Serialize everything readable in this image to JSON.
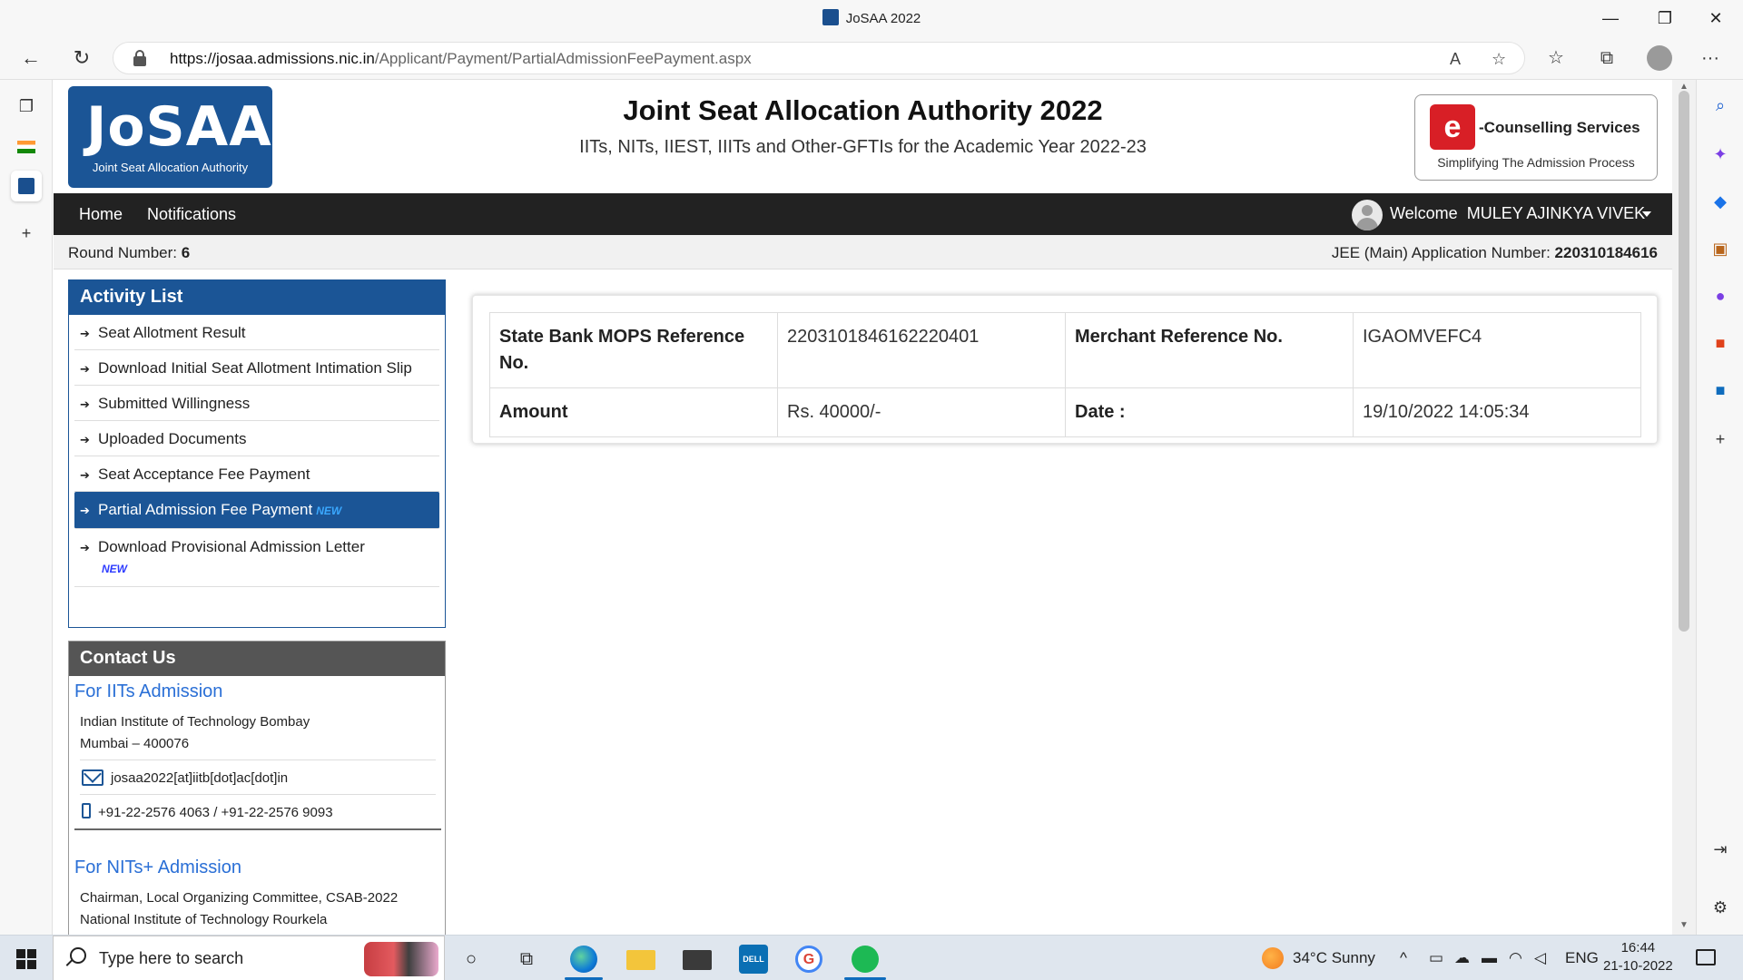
{
  "window": {
    "title": "JoSAA 2022",
    "minimize": "—",
    "restore": "❐",
    "close": "✕"
  },
  "browser": {
    "url_host": "https://josaa.admissions.nic.in",
    "url_path": "/Applicant/Payment/PartialAdmissionFeePayment.aspx",
    "back": "←",
    "reload": "↻",
    "more": "···",
    "read_aloud": "A",
    "fav_add": "☆",
    "favorites": "☆",
    "collections": "⧉"
  },
  "vtabs": {
    "tab_manager": "❐",
    "add_tab": "+"
  },
  "header": {
    "logo_text": "JoSAA",
    "logo_subtext": "Joint Seat Allocation Authority",
    "title": "Joint Seat Allocation Authority 2022",
    "subtitle": "IITs, NITs, IIEST, IIITs and Other-GFTIs for the Academic Year 2022-23",
    "ec_logo_letter": "e",
    "ec_logo_title": "-Counselling Services",
    "ec_logo_tagline": "Simplifying The Admission Process"
  },
  "menu": {
    "home": "Home",
    "notifications": "Notifications",
    "welcome": "Welcome",
    "user_name": "MULEY AJINKYA VIVEK"
  },
  "round": {
    "label": "Round Number:",
    "value": "6",
    "app_label": "JEE (Main) Application Number:",
    "app_value": "220310184616"
  },
  "activity": {
    "title": "Activity List",
    "items": [
      {
        "label": "Seat Allotment Result",
        "new": ""
      },
      {
        "label": "Download Initial Seat Allotment Intimation Slip",
        "new": ""
      },
      {
        "label": "Submitted Willingness",
        "new": ""
      },
      {
        "label": "Uploaded Documents",
        "new": ""
      },
      {
        "label": "Seat Acceptance Fee Payment",
        "new": ""
      },
      {
        "label": "Partial Admission Fee Payment",
        "new": "NEW"
      },
      {
        "label": "Download Provisional Admission Letter",
        "new": "NEW"
      }
    ]
  },
  "contact": {
    "title": "Contact Us",
    "iit_heading": "For IITs Admission",
    "iit_line1": "Indian Institute of Technology Bombay",
    "iit_line2": "Mumbai – 400076",
    "iit_email": "josaa2022[at]iitb[dot]ac[dot]in",
    "iit_phone": "+91-22-2576 4063 / +91-22-2576 9093",
    "nit_heading": "For NITs+ Admission",
    "nit_line1": "Chairman, Local Organizing Committee, CSAB-2022",
    "nit_line2": "National Institute of Technology Rourkela"
  },
  "payment": {
    "mops_label": "State Bank MOPS Reference No.",
    "mops_value": "2203101846162220401",
    "merchant_label": "Merchant Reference No.",
    "merchant_value": "IGAOMVEFC4",
    "amount_label": "Amount",
    "amount_value": "Rs. 40000/-",
    "date_label": "Date :",
    "date_value": "19/10/2022 14:05:34"
  },
  "taskbar": {
    "search_placeholder": "Type here to search",
    "weather": "34°C  Sunny",
    "lang": "ENG",
    "time": "16:44",
    "date": "21-10-2022",
    "cortana": "○",
    "taskview": "⧉",
    "google_letter": "G",
    "dell_label": "DELL",
    "tray_up": "^"
  }
}
